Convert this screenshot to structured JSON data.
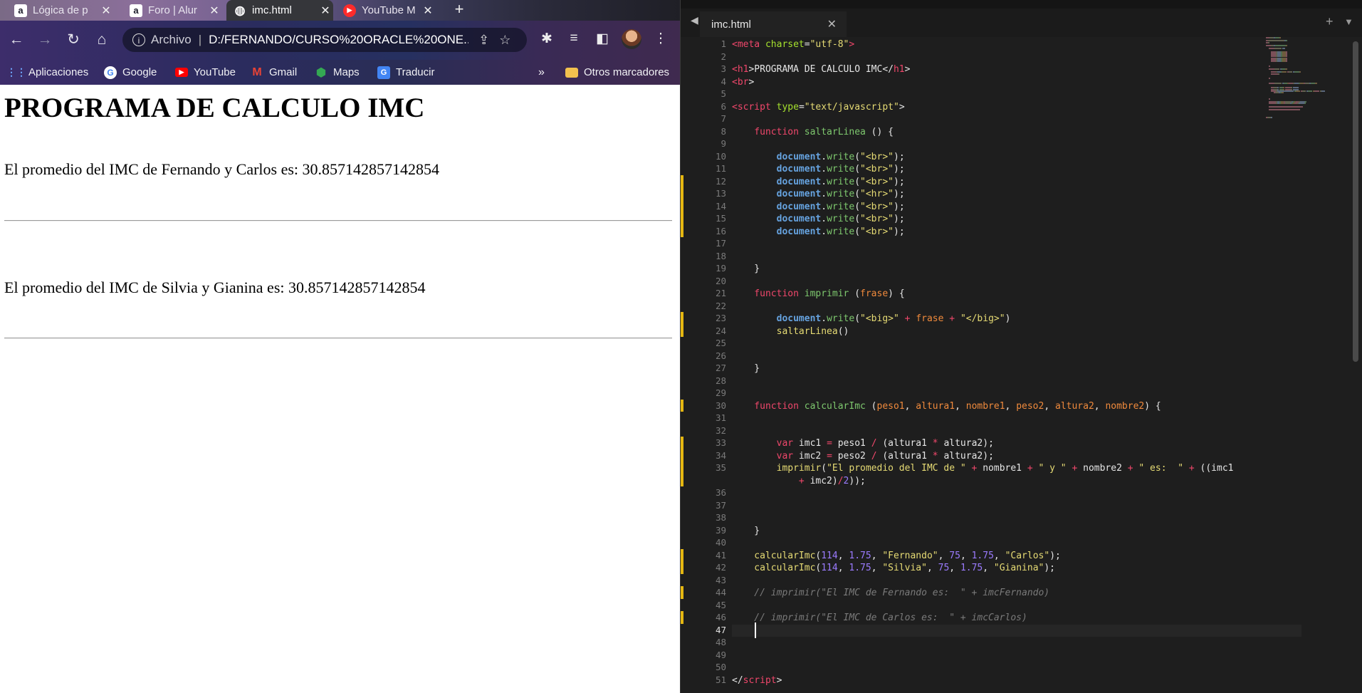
{
  "browser": {
    "tabs": [
      {
        "title": "Lógica de p",
        "favicon": "A",
        "favicon_color": "#1b1b2a"
      },
      {
        "title": "Foro | Alur",
        "favicon": "A",
        "favicon_color": "#1b1b2a"
      },
      {
        "title": "imc.html",
        "favicon": "globe",
        "favicon_color": "#35363a",
        "active": true
      },
      {
        "title": "YouTube M",
        "favicon": "play",
        "favicon_color": "#ff2b2b"
      }
    ],
    "toolbar": {
      "archivo_label": "Archivo",
      "url": "D:/FERNANDO/CURSO%20ORACLE%20ONE..."
    },
    "bookmarks": {
      "items": [
        {
          "label": "Aplicaciones",
          "icon": "apps-grid-icon"
        },
        {
          "label": "Google",
          "icon": "google-icon"
        },
        {
          "label": "YouTube",
          "icon": "youtube-icon"
        },
        {
          "label": "Gmail",
          "icon": "gmail-icon"
        },
        {
          "label": "Maps",
          "icon": "maps-icon"
        },
        {
          "label": "Traducir",
          "icon": "translate-icon"
        }
      ],
      "overflow": "»",
      "other": "Otros marcadores"
    },
    "page": {
      "heading": "PROGRAMA DE CALCULO IMC",
      "line1": "El promedio del IMC de Fernando y Carlos es: 30.857142857142854",
      "line2": "El promedio del IMC de Silvia y Gianina es: 30.857142857142854"
    }
  },
  "editor": {
    "tab_title": "imc.html",
    "current_line": 47,
    "modified_lines": [
      12,
      13,
      14,
      15,
      16,
      23,
      24,
      30,
      33,
      34,
      35,
      41,
      42,
      44,
      46
    ],
    "lines": {
      "1": [
        [
          "tg",
          "<meta "
        ],
        [
          "at",
          "charset"
        ],
        [
          "pl",
          "="
        ],
        [
          "st",
          "\"utf-8\""
        ],
        [
          "tg",
          ">"
        ]
      ],
      "2": [],
      "3": [
        [
          "tg",
          "<h1"
        ],
        [
          "pl",
          ">PROGRAMA DE CALCULO IMC</"
        ],
        [
          "tg",
          "h1"
        ],
        [
          "pl",
          ">"
        ]
      ],
      "4": [
        [
          "tg",
          "<br"
        ],
        [
          "pl",
          ">"
        ]
      ],
      "5": [],
      "6": [
        [
          "tg",
          "<script "
        ],
        [
          "at",
          "type"
        ],
        [
          "pl",
          "="
        ],
        [
          "st",
          "\"text/javascript\""
        ],
        [
          "pl",
          ">"
        ]
      ],
      "7": [],
      "8": [
        [
          "kw",
          "    function "
        ],
        [
          "fn",
          "saltarLinea"
        ],
        [
          "pl",
          " () {"
        ]
      ],
      "9": [],
      "10": [
        [
          "doc",
          "        document"
        ],
        [
          "pl",
          "."
        ],
        [
          "fn",
          "write"
        ],
        [
          "pl",
          "("
        ],
        [
          "st",
          "\"<br>\""
        ],
        [
          "pl",
          ");"
        ]
      ],
      "11": [
        [
          "doc",
          "        document"
        ],
        [
          "pl",
          "."
        ],
        [
          "fn",
          "write"
        ],
        [
          "pl",
          "("
        ],
        [
          "st",
          "\"<br>\""
        ],
        [
          "pl",
          ");"
        ]
      ],
      "12": [
        [
          "doc",
          "        document"
        ],
        [
          "pl",
          "."
        ],
        [
          "fn",
          "write"
        ],
        [
          "pl",
          "("
        ],
        [
          "st",
          "\"<br>\""
        ],
        [
          "pl",
          ");"
        ]
      ],
      "13": [
        [
          "doc",
          "        document"
        ],
        [
          "pl",
          "."
        ],
        [
          "fn",
          "write"
        ],
        [
          "pl",
          "("
        ],
        [
          "st",
          "\"<hr>\""
        ],
        [
          "pl",
          ");"
        ]
      ],
      "14": [
        [
          "doc",
          "        document"
        ],
        [
          "pl",
          "."
        ],
        [
          "fn",
          "write"
        ],
        [
          "pl",
          "("
        ],
        [
          "st",
          "\"<br>\""
        ],
        [
          "pl",
          ");"
        ]
      ],
      "15": [
        [
          "doc",
          "        document"
        ],
        [
          "pl",
          "."
        ],
        [
          "fn",
          "write"
        ],
        [
          "pl",
          "("
        ],
        [
          "st",
          "\"<br>\""
        ],
        [
          "pl",
          ");"
        ]
      ],
      "16": [
        [
          "doc",
          "        document"
        ],
        [
          "pl",
          "."
        ],
        [
          "fn",
          "write"
        ],
        [
          "pl",
          "("
        ],
        [
          "st",
          "\"<br>\""
        ],
        [
          "pl",
          ");"
        ]
      ],
      "17": [],
      "18": [],
      "19": [
        [
          "pl",
          "    }"
        ]
      ],
      "20": [],
      "21": [
        [
          "kw",
          "    function "
        ],
        [
          "fn",
          "imprimir"
        ],
        [
          "pl",
          " ("
        ],
        [
          "pr",
          "frase"
        ],
        [
          "pl",
          ") {"
        ]
      ],
      "22": [],
      "23": [
        [
          "doc",
          "        document"
        ],
        [
          "pl",
          "."
        ],
        [
          "fn",
          "write"
        ],
        [
          "pl",
          "("
        ],
        [
          "st",
          "\"<big>\""
        ],
        [
          "op",
          " + "
        ],
        [
          "pr",
          "frase"
        ],
        [
          "op",
          " + "
        ],
        [
          "st",
          "\"</big>\""
        ],
        [
          "pl",
          ")"
        ]
      ],
      "24": [
        [
          "st",
          "        saltarLinea"
        ],
        [
          "pl",
          "()"
        ]
      ],
      "25": [],
      "26": [],
      "27": [
        [
          "pl",
          "    }"
        ]
      ],
      "28": [],
      "29": [],
      "30": [
        [
          "kw",
          "    function "
        ],
        [
          "fn",
          "calcularImc"
        ],
        [
          "pl",
          " ("
        ],
        [
          "pr",
          "peso1"
        ],
        [
          "pl",
          ", "
        ],
        [
          "pr",
          "altura1"
        ],
        [
          "pl",
          ", "
        ],
        [
          "pr",
          "nombre1"
        ],
        [
          "pl",
          ", "
        ],
        [
          "pr",
          "peso2"
        ],
        [
          "pl",
          ", "
        ],
        [
          "pr",
          "altura2"
        ],
        [
          "pl",
          ", "
        ],
        [
          "pr",
          "nombre2"
        ],
        [
          "pl",
          ") {"
        ]
      ],
      "31": [],
      "32": [],
      "33": [
        [
          "kw",
          "        var "
        ],
        [
          "pl",
          "imc1 "
        ],
        [
          "op",
          "="
        ],
        [
          "pl",
          " peso1 "
        ],
        [
          "op",
          "/"
        ],
        [
          "pl",
          " (altura1 "
        ],
        [
          "op",
          "*"
        ],
        [
          "pl",
          " altura2);"
        ]
      ],
      "34": [
        [
          "kw",
          "        var "
        ],
        [
          "pl",
          "imc2 "
        ],
        [
          "op",
          "="
        ],
        [
          "pl",
          " peso2 "
        ],
        [
          "op",
          "/"
        ],
        [
          "pl",
          " (altura1 "
        ],
        [
          "op",
          "*"
        ],
        [
          "pl",
          " altura2);"
        ]
      ],
      "35": [
        [
          "st",
          "        imprimir"
        ],
        [
          "pl",
          "("
        ],
        [
          "st",
          "\"El promedio del IMC de \""
        ],
        [
          "op",
          " + "
        ],
        [
          "pl",
          "nombre1"
        ],
        [
          "op",
          " + "
        ],
        [
          "st",
          "\" y \""
        ],
        [
          "op",
          " + "
        ],
        [
          "pl",
          "nombre2"
        ],
        [
          "op",
          " + "
        ],
        [
          "st",
          "\" es:  \""
        ],
        [
          "op",
          " + "
        ],
        [
          "pl",
          "((imc1"
        ]
      ],
      "35b": [
        [
          "op",
          "            + "
        ],
        [
          "pl",
          "imc2)"
        ],
        [
          "op",
          "/"
        ],
        [
          "nm",
          "2"
        ],
        [
          "pl",
          "));"
        ]
      ],
      "36": [],
      "37": [],
      "38": [],
      "39": [
        [
          "pl",
          "    }"
        ]
      ],
      "40": [],
      "41": [
        [
          "st",
          "    calcularImc"
        ],
        [
          "pl",
          "("
        ],
        [
          "nm",
          "114"
        ],
        [
          "pl",
          ", "
        ],
        [
          "nm",
          "1.75"
        ],
        [
          "pl",
          ", "
        ],
        [
          "st",
          "\"Fernando\""
        ],
        [
          "pl",
          ", "
        ],
        [
          "nm",
          "75"
        ],
        [
          "pl",
          ", "
        ],
        [
          "nm",
          "1.75"
        ],
        [
          "pl",
          ", "
        ],
        [
          "st",
          "\"Carlos\""
        ],
        [
          "pl",
          ");"
        ]
      ],
      "42": [
        [
          "st",
          "    calcularImc"
        ],
        [
          "pl",
          "("
        ],
        [
          "nm",
          "114"
        ],
        [
          "pl",
          ", "
        ],
        [
          "nm",
          "1.75"
        ],
        [
          "pl",
          ", "
        ],
        [
          "st",
          "\"Silvia\""
        ],
        [
          "pl",
          ", "
        ],
        [
          "nm",
          "75"
        ],
        [
          "pl",
          ", "
        ],
        [
          "nm",
          "1.75"
        ],
        [
          "pl",
          ", "
        ],
        [
          "st",
          "\"Gianina\""
        ],
        [
          "pl",
          ");"
        ]
      ],
      "43": [],
      "44": [
        [
          "cm",
          "    // imprimir(\"El IMC de Fernando es:  \" + imcFernando)"
        ]
      ],
      "45": [],
      "46": [
        [
          "cm",
          "    // imprimir(\"El IMC de Carlos es:  \" + imcCarlos)"
        ]
      ],
      "47": [],
      "48": [],
      "49": [],
      "50": [],
      "51": [
        [
          "pl",
          "</"
        ],
        [
          "tg",
          "script"
        ],
        [
          "pl",
          ">"
        ]
      ]
    }
  }
}
